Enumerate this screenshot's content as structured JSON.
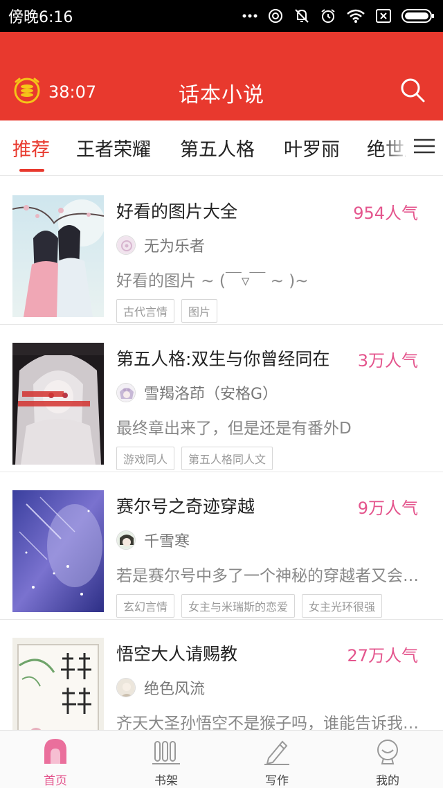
{
  "status_bar": {
    "time": "傍晚6:16",
    "icons": [
      "more-dots-icon",
      "hotspot-icon",
      "mute-icon",
      "alarm-icon",
      "wifi-icon",
      "sim-icon",
      "battery-icon"
    ]
  },
  "header": {
    "timer_text": "38:07",
    "title": "话本小说",
    "icons": [
      "coin-timer-icon",
      "search-icon"
    ]
  },
  "tabs": [
    {
      "label": "推荐",
      "active": true
    },
    {
      "label": "王者荣耀",
      "active": false
    },
    {
      "label": "第五人格",
      "active": false
    },
    {
      "label": "叶罗丽",
      "active": false
    },
    {
      "label": "绝世唐门",
      "active": false
    }
  ],
  "books": [
    {
      "title": "好看的图片大全",
      "popularity": "954人气",
      "author": "无为乐者",
      "summary": "好看的图片 ~ (￣▿￣ ~ )~",
      "tags": [
        "古代言情",
        "图片"
      ]
    },
    {
      "title": "第五人格:双生与你曾经同在",
      "popularity": "3万人气",
      "author": "雪羯洛茚（安格G）",
      "summary": "最终章出来了，但是还是有番外D",
      "tags": [
        "游戏同人",
        "第五人格同人文"
      ]
    },
    {
      "title": "赛尔号之奇迹穿越",
      "popularity": "9万人气",
      "author": "千雪寒",
      "summary": "若是赛尔号中多了一个神秘的穿越者又会是怎样",
      "tags": [
        "玄幻言情",
        "女主与米瑞斯的恋爱",
        "女主光环很强"
      ]
    },
    {
      "title": "悟空大人请赐教",
      "popularity": "27万人气",
      "author": "绝色风流",
      "summary": "齐天大圣孙悟空不是猴子吗，谁能告诉我这是怎么回事",
      "tags": []
    }
  ],
  "bottom_nav": [
    {
      "label": "首页",
      "icon": "home-icon",
      "active": true
    },
    {
      "label": "书架",
      "icon": "bookshelf-icon",
      "active": false
    },
    {
      "label": "写作",
      "icon": "pen-icon",
      "active": false
    },
    {
      "label": "我的",
      "icon": "profile-icon",
      "active": false
    }
  ],
  "colors": {
    "header_red": "#e8392e",
    "popularity_pink": "#e4558d",
    "status_bar": "#000000"
  }
}
